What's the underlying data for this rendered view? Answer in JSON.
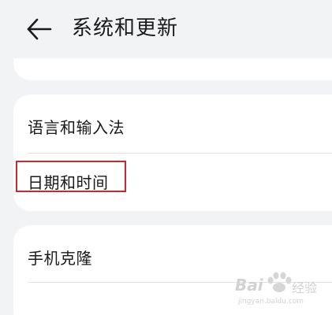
{
  "header": {
    "title": "系统和更新",
    "back_icon": "arrow-left-icon"
  },
  "settings": {
    "group_mid": [
      {
        "label": "语言和输入法"
      },
      {
        "label": "日期和时间",
        "highlighted": true
      }
    ],
    "group_bottom": [
      {
        "label": "手机克隆"
      }
    ]
  },
  "watermark": {
    "brand": "Bai",
    "brand_suffix": "经验",
    "url": "jingyan.baidu.com"
  },
  "colors": {
    "background": "#f1f3f5",
    "card": "#ffffff",
    "text": "#1a1a1a",
    "highlight_border": "#c82a30"
  }
}
